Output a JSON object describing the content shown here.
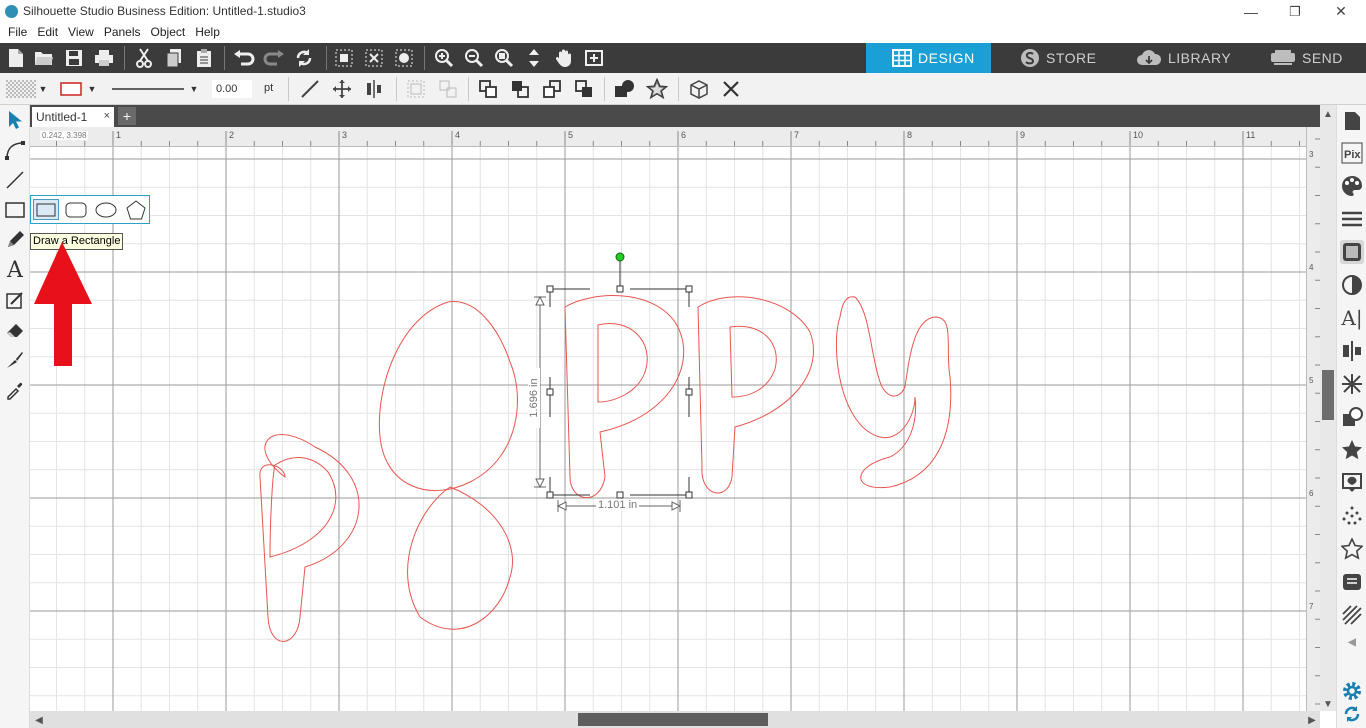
{
  "window": {
    "title": "Silhouette Studio Business Edition: Untitled-1.studio3",
    "controls": {
      "minimize": "—",
      "restore": "❐",
      "close": "✕"
    }
  },
  "menu": [
    "File",
    "Edit",
    "View",
    "Panels",
    "Object",
    "Help"
  ],
  "mode_tabs": [
    {
      "label": "DESIGN",
      "icon": "grid-icon",
      "active": true
    },
    {
      "label": "STORE",
      "icon": "silhouette-s-icon",
      "active": false
    },
    {
      "label": "LIBRARY",
      "icon": "cloud-icon",
      "active": false
    },
    {
      "label": "SEND",
      "icon": "cutter-icon",
      "active": false
    }
  ],
  "line_style": {
    "width_value": "0.00",
    "unit": "pt"
  },
  "document_tab": {
    "label": "Untitled-1",
    "close": "×",
    "add": "+"
  },
  "ruler": {
    "cursor_coords": "0.242, 3.398",
    "h_labels": [
      "1",
      "2",
      "3",
      "4",
      "5",
      "6",
      "7",
      "8",
      "9",
      "10",
      "11"
    ],
    "v_labels": [
      "3",
      "4",
      "5",
      "6",
      "7"
    ]
  },
  "shape_flyout": {
    "options": [
      "rectangle",
      "rounded-rectangle",
      "ellipse",
      "polygon"
    ],
    "selected": "rectangle",
    "tooltip": "Draw a Rectangle"
  },
  "design": {
    "text": "Poppy",
    "stroke_color": "#e8564f",
    "selection_height": "1.696 in",
    "selection_width": "1.101 in"
  },
  "colors": {
    "accent": "#1aa0d4",
    "toolbar_dark": "#3b3b3b",
    "annotation_arrow": "#e81019",
    "rotate_handle": "#22cc22"
  }
}
